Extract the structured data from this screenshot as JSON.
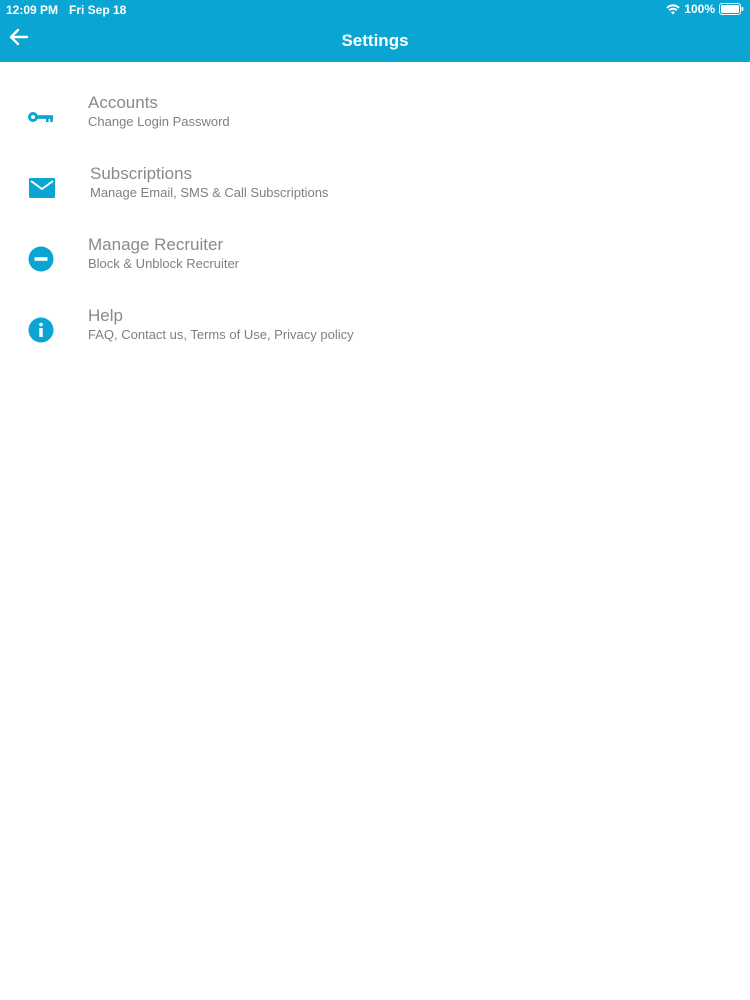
{
  "status_bar": {
    "time": "12:09 PM",
    "date": "Fri Sep 18",
    "battery": "100%",
    "icons": [
      "wifi-icon",
      "battery-icon"
    ]
  },
  "header": {
    "title": "Settings",
    "back_icon": "arrow-left-icon"
  },
  "colors": {
    "accent": "#0aa5d3",
    "title_text": "#8a8a8a",
    "subtitle_text": "#808080"
  },
  "settings": {
    "items": [
      {
        "title": "Accounts",
        "subtitle": "Change Login Password",
        "icon": "key-icon"
      },
      {
        "title": "Subscriptions",
        "subtitle": "Manage Email, SMS & Call Subscriptions",
        "icon": "mail-icon"
      },
      {
        "title": "Manage Recruiter",
        "subtitle": "Block & Unblock Recruiter",
        "icon": "block-icon"
      },
      {
        "title": "Help",
        "subtitle": "FAQ, Contact us, Terms of Use, Privacy policy",
        "icon": "info-icon"
      }
    ]
  }
}
